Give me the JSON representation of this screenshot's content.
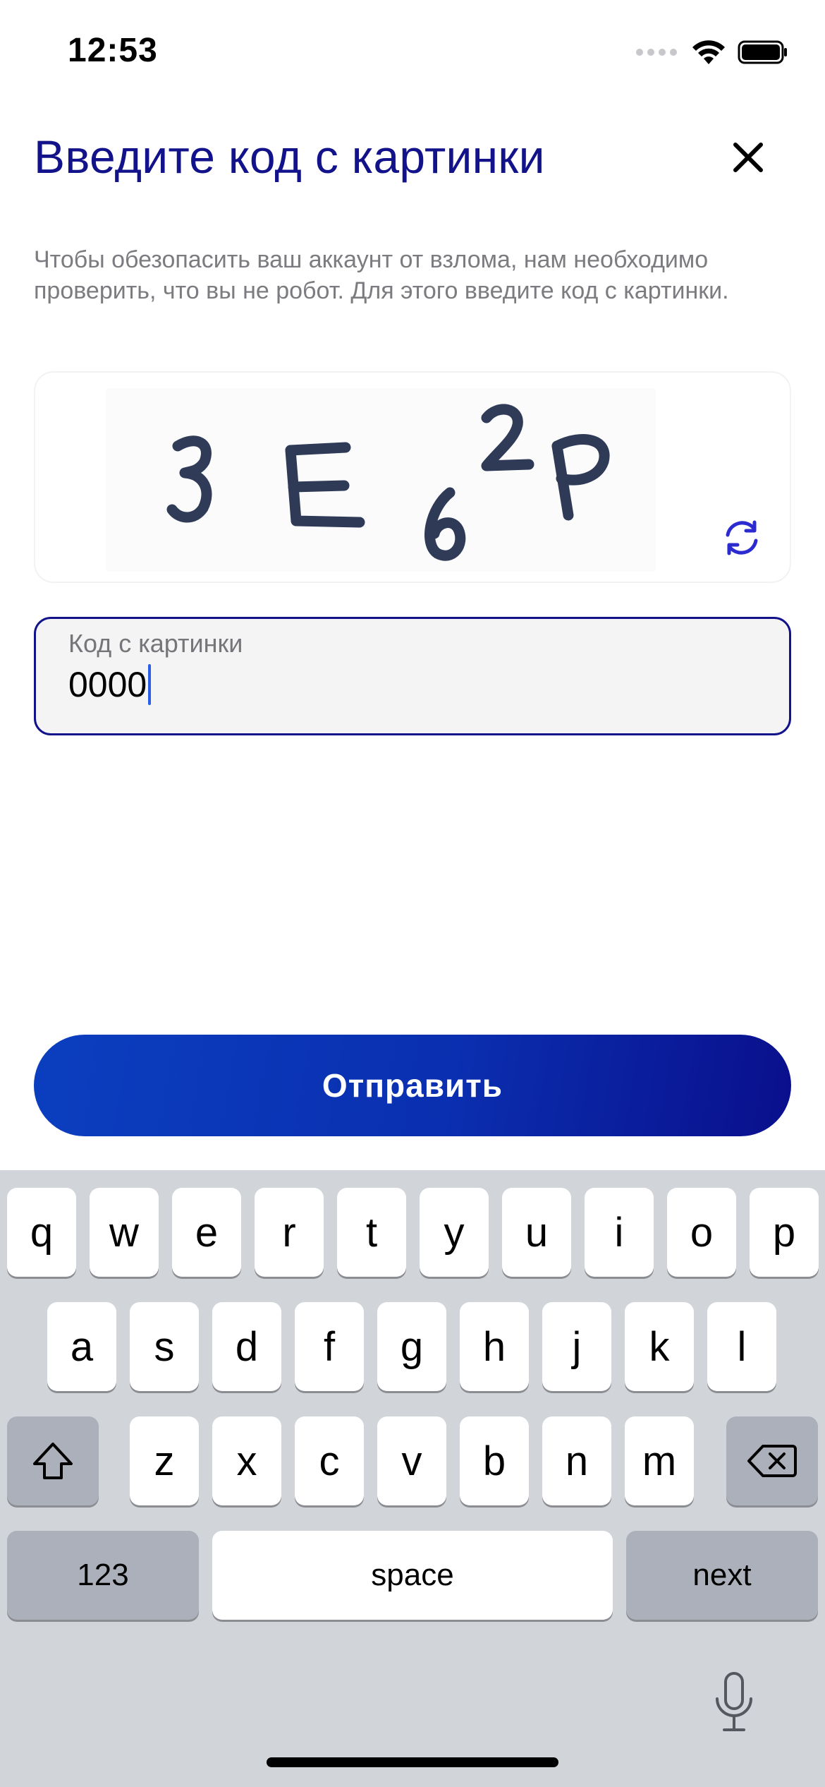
{
  "status_bar": {
    "time": "12:53"
  },
  "header": {
    "title": "Введите код с картинки"
  },
  "description": "Чтобы обезопасить ваш аккаунт от взлома, нам необходимо проверить, что вы не робот. Для этого введите код с картинки.",
  "captcha": {
    "characters": [
      "3",
      "E",
      "6",
      "2",
      "P"
    ]
  },
  "input": {
    "label": "Код с картинки",
    "value": "0000"
  },
  "submit": {
    "label": "Отправить"
  },
  "colors": {
    "title": "#12128a",
    "accent": "#2b2bd0",
    "button_start": "#0b3fbf",
    "button_end": "#0a0f8c"
  },
  "keyboard": {
    "row1": [
      "q",
      "w",
      "e",
      "r",
      "t",
      "y",
      "u",
      "i",
      "o",
      "p"
    ],
    "row2": [
      "a",
      "s",
      "d",
      "f",
      "g",
      "h",
      "j",
      "k",
      "l"
    ],
    "row3": [
      "z",
      "x",
      "c",
      "v",
      "b",
      "n",
      "m"
    ],
    "numbers_label": "123",
    "space_label": "space",
    "return_label": "next"
  }
}
